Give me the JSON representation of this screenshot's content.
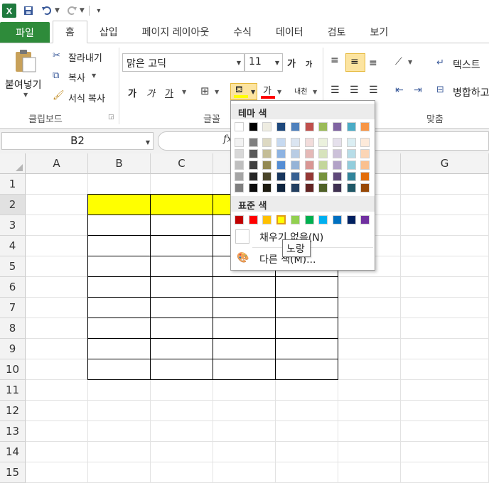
{
  "quick_access": {
    "app_icon": "X",
    "icons": [
      "save-icon",
      "undo-icon",
      "redo-icon",
      "customize-icon"
    ]
  },
  "tabs": [
    {
      "label": "파일"
    },
    {
      "label": "홈"
    },
    {
      "label": "삽입"
    },
    {
      "label": "페이지 레이아웃"
    },
    {
      "label": "수식"
    },
    {
      "label": "데이터"
    },
    {
      "label": "검토"
    },
    {
      "label": "보기"
    }
  ],
  "ribbon": {
    "clipboard": {
      "paste": "붙여넣기",
      "cut": "잘라내기",
      "copy": "복사",
      "format_painter": "서식 복사",
      "group_label": "클립보드"
    },
    "font": {
      "font_name": "맑은 고딕",
      "font_size": "11",
      "increase": "가",
      "decrease": "가",
      "bold": "가",
      "italic": "가",
      "underline": "가",
      "font_color_label": "가",
      "phonetic": "내천",
      "group_label": "글꼴",
      "fill_color": "#ffff00",
      "font_color": "#ff0000"
    },
    "alignment": {
      "wrap_text": "텍스트",
      "merge": "병합하고",
      "group_label": "맞춤"
    }
  },
  "formula_bar": {
    "name_box": "B2",
    "fx_label": "fx"
  },
  "sheet": {
    "columns": [
      "A",
      "B",
      "C",
      "D",
      "E",
      "F",
      "G"
    ],
    "rows": [
      "1",
      "2",
      "3",
      "4",
      "5",
      "6",
      "7",
      "8",
      "9",
      "10",
      "11",
      "12",
      "13",
      "14",
      "15"
    ],
    "selected_row": "2",
    "fill_color": "#ffff00"
  },
  "color_menu": {
    "theme_title": "테마 색",
    "standard_title": "표준 색",
    "theme_top": [
      "#ffffff",
      "#000000",
      "#eeece1",
      "#1f497d",
      "#4f81bd",
      "#c0504d",
      "#9bbb59",
      "#8064a2",
      "#4bacc6",
      "#f79646"
    ],
    "theme_shades": [
      [
        "#f2f2f2",
        "#7f7f7f",
        "#ddd9c3",
        "#c6d9f0",
        "#dbe5f1",
        "#f2dcdb",
        "#ebf1dd",
        "#e5e0ec",
        "#dbeef3",
        "#fdeada"
      ],
      [
        "#d8d8d8",
        "#595959",
        "#c4bd97",
        "#8db3e2",
        "#b8cce4",
        "#e5b9b7",
        "#d7e3bc",
        "#ccc1d9",
        "#b7dde8",
        "#fbd5b5"
      ],
      [
        "#bfbfbf",
        "#3f3f3f",
        "#938953",
        "#548dd4",
        "#95b3d7",
        "#d99694",
        "#c3d69b",
        "#b2a2c7",
        "#92cddc",
        "#fac08f"
      ],
      [
        "#a5a5a5",
        "#262626",
        "#494429",
        "#17365d",
        "#366092",
        "#953734",
        "#76923c",
        "#5f497a",
        "#31859b",
        "#e36c09"
      ],
      [
        "#7f7f7f",
        "#0c0c0c",
        "#1d1b10",
        "#0f243e",
        "#244061",
        "#632423",
        "#4f6128",
        "#3f3151",
        "#205867",
        "#974806"
      ]
    ],
    "standard": [
      "#c00000",
      "#ff0000",
      "#ffc000",
      "#ffff00",
      "#92d050",
      "#00b050",
      "#00b0f0",
      "#0070c0",
      "#002060",
      "#7030a0"
    ],
    "selected_standard": "#ffff00",
    "no_fill": "채우기 없음(N)",
    "more_colors": "다른 색(M)...",
    "tooltip": "노랑"
  }
}
